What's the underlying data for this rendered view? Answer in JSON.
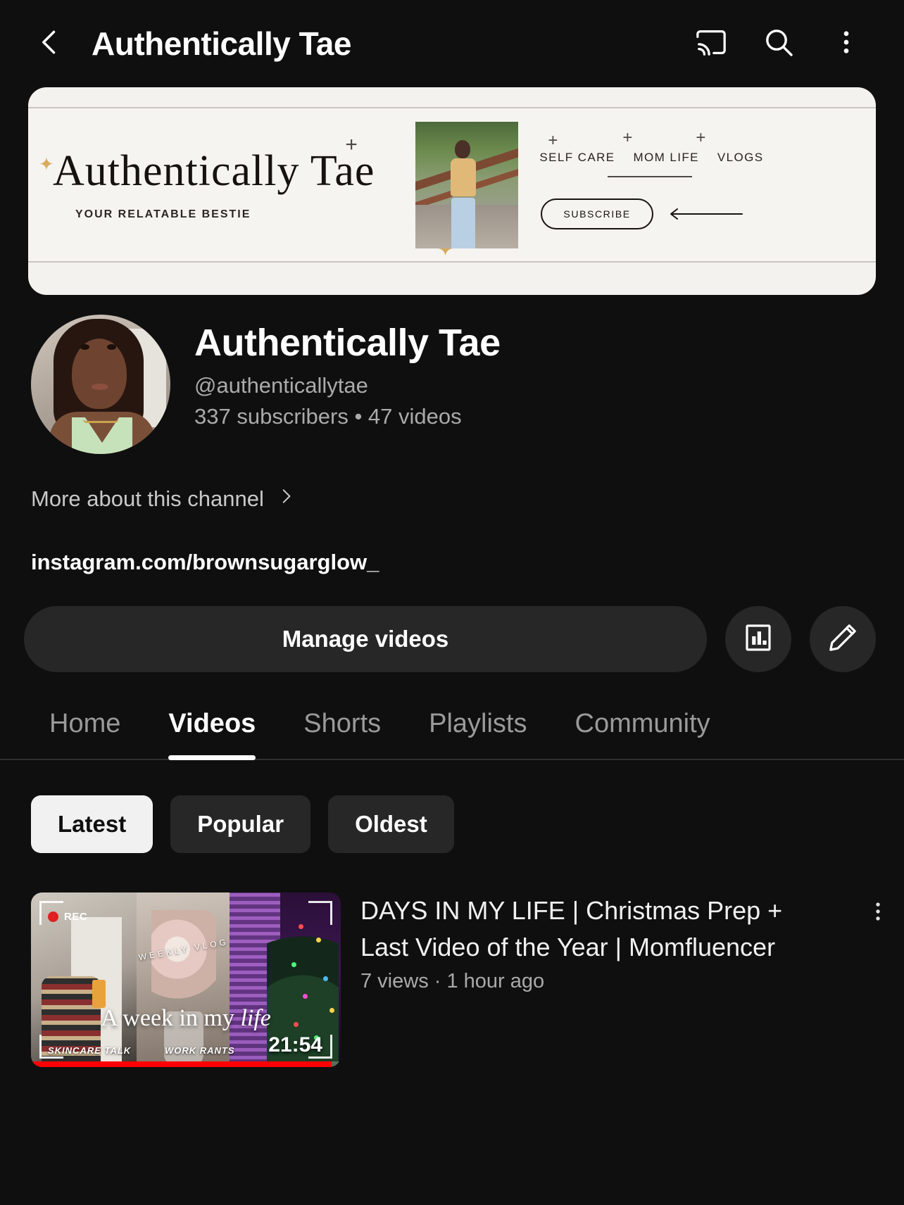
{
  "header": {
    "title": "Authentically Tae",
    "back_icon": "back-arrow-icon",
    "cast_icon": "cast-icon",
    "search_icon": "search-icon",
    "overflow_icon": "more-vertical-icon"
  },
  "banner": {
    "name": "Authentically Tae",
    "tagline": "YOUR RELATABLE BESTIE",
    "categories": [
      "SELF CARE",
      "MOM LIFE",
      "VLOGS"
    ],
    "subscribe_label": "SUBSCRIBE",
    "bg_color": "#f6f4f1",
    "text_color": "#17140f",
    "accent_color": "#d9ab5e"
  },
  "channel": {
    "name": "Authentically Tae",
    "handle": "@authenticallytae",
    "stats": "337 subscribers  •  47 videos",
    "subscribers": "337 subscribers",
    "videos": "47 videos",
    "more_about": "More about this channel",
    "link": "instagram.com/brownsugarglow_"
  },
  "actions": {
    "manage_label": "Manage videos",
    "analytics_icon": "analytics-bar-chart-icon",
    "customize_icon": "pencil-edit-icon"
  },
  "tabs": [
    {
      "label": "Home",
      "active": false
    },
    {
      "label": "Videos",
      "active": true
    },
    {
      "label": "Shorts",
      "active": false
    },
    {
      "label": "Playlists",
      "active": false
    },
    {
      "label": "Community",
      "active": false
    }
  ],
  "chips": [
    {
      "label": "Latest",
      "active": true
    },
    {
      "label": "Popular",
      "active": false
    },
    {
      "label": "Oldest",
      "active": false
    }
  ],
  "videos": [
    {
      "title": "DAYS IN MY LIFE | Christmas Prep + Last Video of the Year | Momfluencer",
      "views": "7 views",
      "age": "1 hour ago",
      "meta": "7 views · 1 hour ago",
      "duration": "21:54",
      "thumbnail": {
        "overlay_title": "A week in my",
        "overlay_title_italic": "life",
        "rec_label": "REC",
        "weekly_vlog": "WEEKLY VLOG",
        "tag_left": "SKINCARE TALK",
        "tag_right": "WORK RANTS",
        "progress_color": "#ff0000"
      },
      "menu_icon": "more-vertical-icon"
    }
  ]
}
